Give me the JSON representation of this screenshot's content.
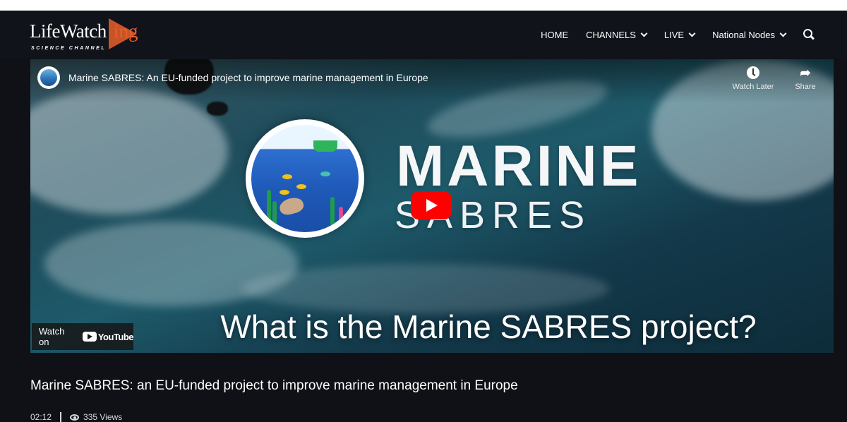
{
  "site": {
    "logo_text": "LifeWatching",
    "logo_main": "LifeWatch",
    "logo_tail": "ing",
    "logo_subtitle": "SCIENCE CHANNEL"
  },
  "nav": {
    "items": [
      {
        "label": "HOME",
        "dropdown": false
      },
      {
        "label": "CHANNELS",
        "dropdown": true
      },
      {
        "label": "LIVE",
        "dropdown": true
      },
      {
        "label": "National Nodes",
        "dropdown": true
      }
    ],
    "search_icon": "search-icon"
  },
  "video": {
    "title": "Marine SABRES: An EU-funded project to improve marine management in Europe",
    "watch_later_label": "Watch Later",
    "share_label": "Share",
    "overlay_title_line1": "MARINE",
    "overlay_title_line2": "SABRES",
    "caption": "What is the Marine SABRES project?",
    "watch_on_label": "Watch on",
    "youtube_label": "YouTube",
    "colors": {
      "play_button": "#ff0000"
    }
  },
  "post": {
    "title": "Marine SABRES: an EU-funded project to improve marine management in Europe",
    "duration": "02:12",
    "views": "335 Views"
  }
}
